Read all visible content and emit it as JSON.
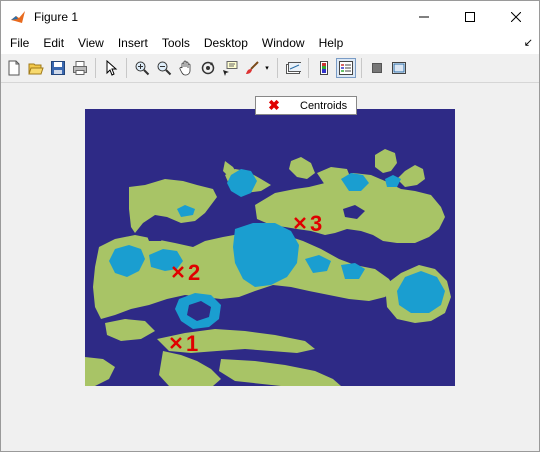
{
  "window": {
    "title": "Figure 1"
  },
  "menu": {
    "items": [
      "File",
      "Edit",
      "View",
      "Insert",
      "Tools",
      "Desktop",
      "Window",
      "Help"
    ]
  },
  "toolbar": {
    "icons": [
      "new-figure-icon",
      "open-file-icon",
      "save-icon",
      "print-icon",
      "edit-plot-icon",
      "zoom-in-icon",
      "zoom-out-icon",
      "pan-icon",
      "rotate-3d-icon",
      "data-cursor-icon",
      "brush-icon",
      "link-plot-icon",
      "colorbar-icon",
      "legend-icon",
      "hide-plot-tools-icon",
      "show-plot-tools-icon"
    ]
  },
  "legend": {
    "label": "Centroids"
  },
  "centroids": [
    {
      "label": "1"
    },
    {
      "label": "2"
    },
    {
      "label": "3"
    }
  ],
  "colors": {
    "background_cluster": "#2e2a86",
    "cluster_green": "#a8c466",
    "cluster_blue": "#1a9ed0",
    "centroid_marker": "#e00000"
  }
}
